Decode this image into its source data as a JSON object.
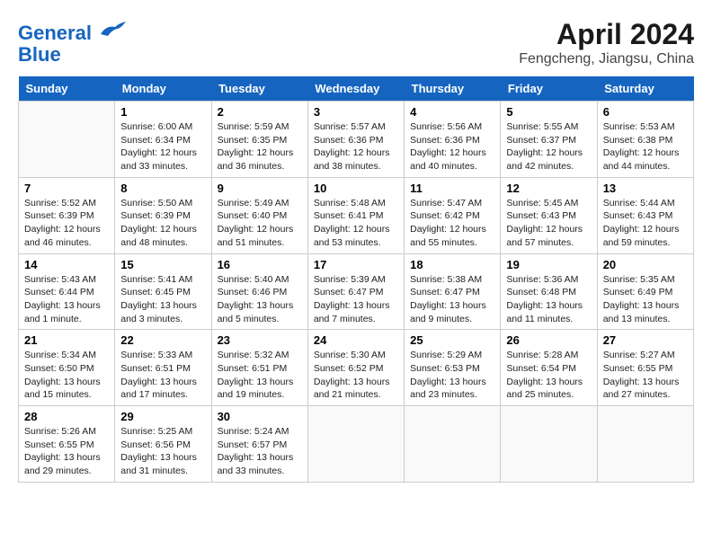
{
  "logo": {
    "line1": "General",
    "line2": "Blue"
  },
  "title": "April 2024",
  "subtitle": "Fengcheng, Jiangsu, China",
  "weekdays": [
    "Sunday",
    "Monday",
    "Tuesday",
    "Wednesday",
    "Thursday",
    "Friday",
    "Saturday"
  ],
  "weeks": [
    [
      {
        "day": "",
        "empty": true
      },
      {
        "day": "1",
        "sunrise": "Sunrise: 6:00 AM",
        "sunset": "Sunset: 6:34 PM",
        "daylight": "Daylight: 12 hours and 33 minutes."
      },
      {
        "day": "2",
        "sunrise": "Sunrise: 5:59 AM",
        "sunset": "Sunset: 6:35 PM",
        "daylight": "Daylight: 12 hours and 36 minutes."
      },
      {
        "day": "3",
        "sunrise": "Sunrise: 5:57 AM",
        "sunset": "Sunset: 6:36 PM",
        "daylight": "Daylight: 12 hours and 38 minutes."
      },
      {
        "day": "4",
        "sunrise": "Sunrise: 5:56 AM",
        "sunset": "Sunset: 6:36 PM",
        "daylight": "Daylight: 12 hours and 40 minutes."
      },
      {
        "day": "5",
        "sunrise": "Sunrise: 5:55 AM",
        "sunset": "Sunset: 6:37 PM",
        "daylight": "Daylight: 12 hours and 42 minutes."
      },
      {
        "day": "6",
        "sunrise": "Sunrise: 5:53 AM",
        "sunset": "Sunset: 6:38 PM",
        "daylight": "Daylight: 12 hours and 44 minutes."
      }
    ],
    [
      {
        "day": "7",
        "sunrise": "Sunrise: 5:52 AM",
        "sunset": "Sunset: 6:39 PM",
        "daylight": "Daylight: 12 hours and 46 minutes."
      },
      {
        "day": "8",
        "sunrise": "Sunrise: 5:50 AM",
        "sunset": "Sunset: 6:39 PM",
        "daylight": "Daylight: 12 hours and 48 minutes."
      },
      {
        "day": "9",
        "sunrise": "Sunrise: 5:49 AM",
        "sunset": "Sunset: 6:40 PM",
        "daylight": "Daylight: 12 hours and 51 minutes."
      },
      {
        "day": "10",
        "sunrise": "Sunrise: 5:48 AM",
        "sunset": "Sunset: 6:41 PM",
        "daylight": "Daylight: 12 hours and 53 minutes."
      },
      {
        "day": "11",
        "sunrise": "Sunrise: 5:47 AM",
        "sunset": "Sunset: 6:42 PM",
        "daylight": "Daylight: 12 hours and 55 minutes."
      },
      {
        "day": "12",
        "sunrise": "Sunrise: 5:45 AM",
        "sunset": "Sunset: 6:43 PM",
        "daylight": "Daylight: 12 hours and 57 minutes."
      },
      {
        "day": "13",
        "sunrise": "Sunrise: 5:44 AM",
        "sunset": "Sunset: 6:43 PM",
        "daylight": "Daylight: 12 hours and 59 minutes."
      }
    ],
    [
      {
        "day": "14",
        "sunrise": "Sunrise: 5:43 AM",
        "sunset": "Sunset: 6:44 PM",
        "daylight": "Daylight: 13 hours and 1 minute."
      },
      {
        "day": "15",
        "sunrise": "Sunrise: 5:41 AM",
        "sunset": "Sunset: 6:45 PM",
        "daylight": "Daylight: 13 hours and 3 minutes."
      },
      {
        "day": "16",
        "sunrise": "Sunrise: 5:40 AM",
        "sunset": "Sunset: 6:46 PM",
        "daylight": "Daylight: 13 hours and 5 minutes."
      },
      {
        "day": "17",
        "sunrise": "Sunrise: 5:39 AM",
        "sunset": "Sunset: 6:47 PM",
        "daylight": "Daylight: 13 hours and 7 minutes."
      },
      {
        "day": "18",
        "sunrise": "Sunrise: 5:38 AM",
        "sunset": "Sunset: 6:47 PM",
        "daylight": "Daylight: 13 hours and 9 minutes."
      },
      {
        "day": "19",
        "sunrise": "Sunrise: 5:36 AM",
        "sunset": "Sunset: 6:48 PM",
        "daylight": "Daylight: 13 hours and 11 minutes."
      },
      {
        "day": "20",
        "sunrise": "Sunrise: 5:35 AM",
        "sunset": "Sunset: 6:49 PM",
        "daylight": "Daylight: 13 hours and 13 minutes."
      }
    ],
    [
      {
        "day": "21",
        "sunrise": "Sunrise: 5:34 AM",
        "sunset": "Sunset: 6:50 PM",
        "daylight": "Daylight: 13 hours and 15 minutes."
      },
      {
        "day": "22",
        "sunrise": "Sunrise: 5:33 AM",
        "sunset": "Sunset: 6:51 PM",
        "daylight": "Daylight: 13 hours and 17 minutes."
      },
      {
        "day": "23",
        "sunrise": "Sunrise: 5:32 AM",
        "sunset": "Sunset: 6:51 PM",
        "daylight": "Daylight: 13 hours and 19 minutes."
      },
      {
        "day": "24",
        "sunrise": "Sunrise: 5:30 AM",
        "sunset": "Sunset: 6:52 PM",
        "daylight": "Daylight: 13 hours and 21 minutes."
      },
      {
        "day": "25",
        "sunrise": "Sunrise: 5:29 AM",
        "sunset": "Sunset: 6:53 PM",
        "daylight": "Daylight: 13 hours and 23 minutes."
      },
      {
        "day": "26",
        "sunrise": "Sunrise: 5:28 AM",
        "sunset": "Sunset: 6:54 PM",
        "daylight": "Daylight: 13 hours and 25 minutes."
      },
      {
        "day": "27",
        "sunrise": "Sunrise: 5:27 AM",
        "sunset": "Sunset: 6:55 PM",
        "daylight": "Daylight: 13 hours and 27 minutes."
      }
    ],
    [
      {
        "day": "28",
        "sunrise": "Sunrise: 5:26 AM",
        "sunset": "Sunset: 6:55 PM",
        "daylight": "Daylight: 13 hours and 29 minutes."
      },
      {
        "day": "29",
        "sunrise": "Sunrise: 5:25 AM",
        "sunset": "Sunset: 6:56 PM",
        "daylight": "Daylight: 13 hours and 31 minutes."
      },
      {
        "day": "30",
        "sunrise": "Sunrise: 5:24 AM",
        "sunset": "Sunset: 6:57 PM",
        "daylight": "Daylight: 13 hours and 33 minutes."
      },
      {
        "day": "",
        "empty": true
      },
      {
        "day": "",
        "empty": true
      },
      {
        "day": "",
        "empty": true
      },
      {
        "day": "",
        "empty": true
      }
    ]
  ]
}
